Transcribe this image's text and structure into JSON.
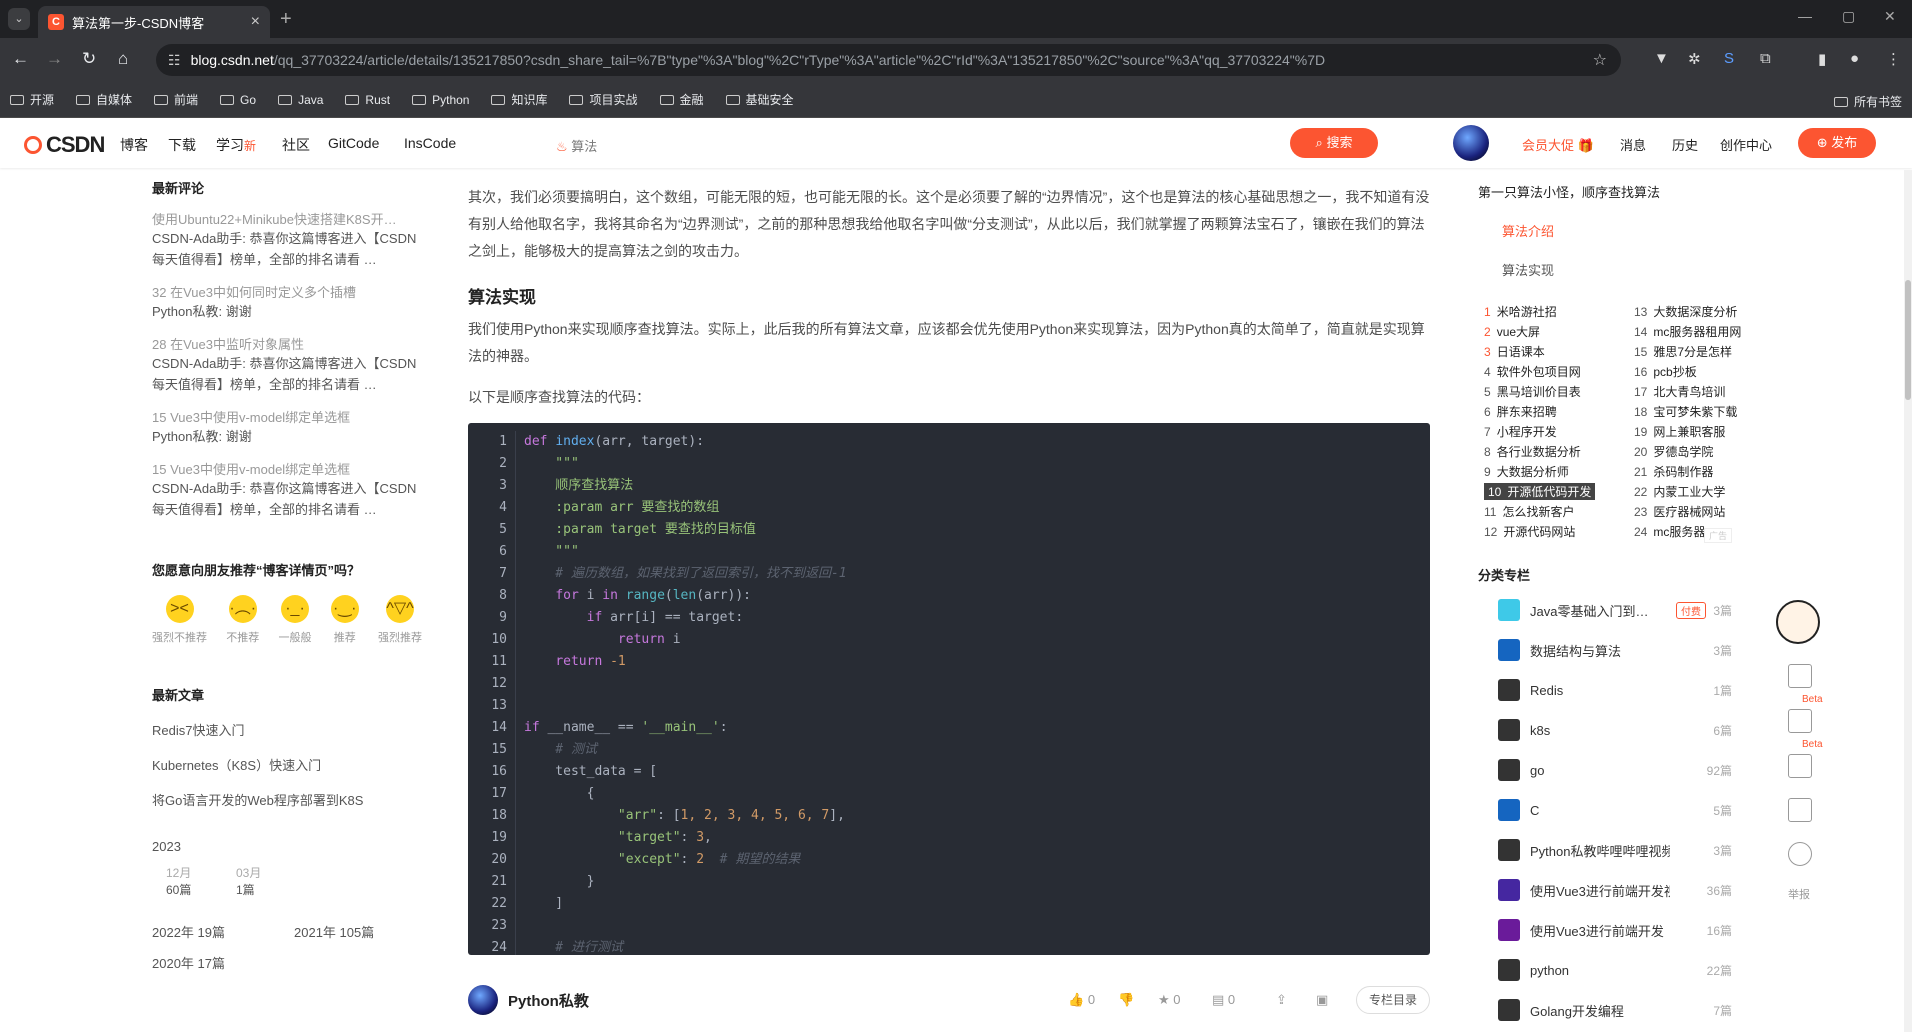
{
  "browser": {
    "tab_title": "算法第一步-CSDN博客",
    "url_domain": "blog.csdn.net",
    "url_path": "/qq_37703224/article/details/135217850?csdn_share_tail=%7B\"type\"%3A\"blog\"%2C\"rType\"%3A\"article\"%2C\"rId\"%3A\"135217850\"%2C\"source\"%3A\"qq_37703224\"%7D",
    "bookmarks": [
      "开源",
      "自媒体",
      "前端",
      "Go",
      "Java",
      "Rust",
      "Python",
      "知识库",
      "项目实战",
      "金融",
      "基础安全"
    ],
    "bookmarks_all": "所有书签"
  },
  "csdn": {
    "logo": "CSDN",
    "nav": [
      {
        "label": "博客"
      },
      {
        "label": "下载"
      },
      {
        "label": "学习",
        "badge": "新"
      },
      {
        "label": "社区"
      },
      {
        "label": "GitCode"
      },
      {
        "label": "InsCode"
      }
    ],
    "search_hint": "算法",
    "search_button": "搜索",
    "vip": "会员大促",
    "right_nav": [
      "消息",
      "历史",
      "创作中心"
    ],
    "publish": "发布"
  },
  "left": {
    "recent_comments_title": "最新评论",
    "comments": [
      {
        "title": "使用Ubuntu22+Minikube快速搭建K8S开…",
        "body": "CSDN-Ada助手: 恭喜你这篇博客进入【CSDN每天值得看】榜单，全部的排名请看 …"
      },
      {
        "title": "32 在Vue3中如何同时定义多个插槽",
        "body": "Python私教: 谢谢"
      },
      {
        "title": "28 在Vue3中监听对象属性",
        "body": "CSDN-Ada助手: 恭喜你这篇博客进入【CSDN每天值得看】榜单，全部的排名请看 …"
      },
      {
        "title": "15 Vue3中使用v-model绑定单选框",
        "body": "Python私教: 谢谢"
      },
      {
        "title": "15 Vue3中使用v-model绑定单选框",
        "body": "CSDN-Ada助手: 恭喜你这篇博客进入【CSDN每天值得看】榜单，全部的排名请看 …"
      }
    ],
    "recommend_question": "您愿意向朋友推荐“博客详情页”吗？",
    "ratings": [
      "强烈不推荐",
      "不推荐",
      "一般般",
      "推荐",
      "强烈推荐"
    ],
    "recent_articles_title": "最新文章",
    "articles": [
      "Redis7快速入门",
      "Kubernetes（K8S）快速入门",
      "将Go语言开发的Web程序部署到K8S"
    ],
    "archive_year": "2023",
    "archive_months": [
      {
        "month": "12月",
        "count": "60篇"
      },
      {
        "month": "03月",
        "count": "1篇"
      }
    ],
    "archive_years": [
      {
        "year": "2022年",
        "count": "19篇"
      },
      {
        "year": "2021年",
        "count": "105篇"
      },
      {
        "year": "2020年",
        "count": "17篇"
      }
    ]
  },
  "main": {
    "para1": "其次，我们必须要搞明白，这个数组，可能无限的短，也可能无限的长。这个是必须要了解的“边界情况”，这个也是算法的核心基础思想之一，我不知道有没有别人给他取名字，我将其命名为“边界测试”，之前的那种思想我给他取名字叫做“分支测试”，从此以后，我们就掌握了两颗算法宝石了，镶嵌在我们的算法之剑上，能够极大的提高算法之剑的攻击力。",
    "heading": "算法实现",
    "para2": "我们使用Python来实现顺序查找算法。实际上，此后我的所有算法文章，应该都会优先使用Python来实现算法，因为Python真的太简单了，简直就是实现算法的神器。",
    "para3": "以下是顺序查找算法的代码：",
    "code": {
      "line_numbers": [
        "1",
        "2",
        "3",
        "4",
        "5",
        "6",
        "7",
        "8",
        "9",
        "10",
        "11",
        "12",
        "13",
        "14",
        "15",
        "16",
        "17",
        "18",
        "19",
        "20",
        "21",
        "22",
        "23",
        "24"
      ],
      "l1_kw": "def",
      "l1_fn": "index",
      "l1_rest": "(arr, target):",
      "l2": "    \"\"\"",
      "l3": "    顺序查找算法",
      "l4a": "    :param arr ",
      "l4b": "要查找的数组",
      "l5a": "    :param target ",
      "l5b": "要查找的目标值",
      "l6": "    \"\"\"",
      "l7": "    # 遍历数组，如果找到了返回索引，找不到返回-1",
      "l8a": "    ",
      "l8kw": "for",
      "l8b": " i ",
      "l8kw2": "in",
      "l8c": " ",
      "l8bi": "range",
      "l8d": "(",
      "l8bi2": "len",
      "l8e": "(arr)):",
      "l9a": "        ",
      "l9kw": "if",
      "l9b": " arr[i] == target:",
      "l10a": "            ",
      "l10kw": "return",
      "l10b": " i",
      "l11a": "    ",
      "l11kw": "return",
      "l11num": " -1",
      "l14kw": "if",
      "l14a": " __name__ == ",
      "l14str": "'__main__'",
      "l14b": ":",
      "l15": "    # 测试",
      "l16": "    test_data = [",
      "l17": "        {",
      "l18a": "            ",
      "l18str": "\"arr\"",
      "l18b": ": [",
      "l18num": "1, 2, 3, 4, 5, 6, 7",
      "l18c": "],",
      "l19a": "            ",
      "l19str": "\"target\"",
      "l19b": ": ",
      "l19num": "3",
      "l19c": ",",
      "l20a": "            ",
      "l20str": "\"except\"",
      "l20b": ": ",
      "l20num": "2",
      "l20cm": "  # 期望的结果",
      "l21": "        }",
      "l22": "    ]",
      "l24": "    # 进行测试"
    },
    "author": "Python私教",
    "counts": [
      "0",
      "0",
      "0"
    ],
    "column_button": "专栏目录"
  },
  "right": {
    "toc_title": "第一只算法小怪，顺序查找算法",
    "toc_items": [
      "算法介绍",
      "算法实现"
    ],
    "hot": [
      {
        "n": "1",
        "t": "米哈游社招"
      },
      {
        "n": "2",
        "t": "vue大屏"
      },
      {
        "n": "3",
        "t": "日语课本"
      },
      {
        "n": "4",
        "t": "软件外包项目网"
      },
      {
        "n": "5",
        "t": "黑马培训价目表"
      },
      {
        "n": "6",
        "t": "胖东来招聘"
      },
      {
        "n": "7",
        "t": "小程序开发"
      },
      {
        "n": "8",
        "t": "各行业数据分析"
      },
      {
        "n": "9",
        "t": "大数据分析师"
      },
      {
        "n": "10",
        "t": "开源低代码开发"
      },
      {
        "n": "11",
        "t": "怎么找新客户"
      },
      {
        "n": "12",
        "t": "开源代码网站"
      },
      {
        "n": "13",
        "t": "大数据深度分析"
      },
      {
        "n": "14",
        "t": "mc服务器租用网"
      },
      {
        "n": "15",
        "t": "雅思7分是怎样"
      },
      {
        "n": "16",
        "t": "pcb抄板"
      },
      {
        "n": "17",
        "t": "北大青鸟培训"
      },
      {
        "n": "18",
        "t": "宝可梦朱紫下载"
      },
      {
        "n": "19",
        "t": "网上兼职客服"
      },
      {
        "n": "20",
        "t": "罗德岛学院"
      },
      {
        "n": "21",
        "t": "杀码制作器"
      },
      {
        "n": "22",
        "t": "内蒙工业大学"
      },
      {
        "n": "23",
        "t": "医疗器械网站"
      },
      {
        "n": "24",
        "t": "mc服务器"
      }
    ],
    "ad": "广告",
    "cat_title": "分类专栏",
    "categories": [
      {
        "name": "Java零基础入门到…",
        "count": "3篇",
        "paid": "付费",
        "color": "#3ec9e8"
      },
      {
        "name": "数据结构与算法",
        "count": "3篇",
        "color": "#1565c0"
      },
      {
        "name": "Redis",
        "count": "1篇",
        "color": "#333"
      },
      {
        "name": "k8s",
        "count": "6篇",
        "color": "#333"
      },
      {
        "name": "go",
        "count": "92篇",
        "color": "#333"
      },
      {
        "name": "C",
        "count": "5篇",
        "color": "#1565c0"
      },
      {
        "name": "Python私教哔哩哔哩视频…",
        "count": "3篇",
        "color": "#333"
      },
      {
        "name": "使用Vue3进行前端开发视…",
        "count": "36篇",
        "color": "#4527a0"
      },
      {
        "name": "使用Vue3进行前端开发",
        "count": "16篇",
        "color": "#6a1b9a"
      },
      {
        "name": "python",
        "count": "22篇",
        "color": "#333"
      },
      {
        "name": "Golang开发编程",
        "count": "7篇",
        "color": "#333"
      }
    ],
    "tools": {
      "beta": "Beta",
      "report": "举报"
    }
  }
}
